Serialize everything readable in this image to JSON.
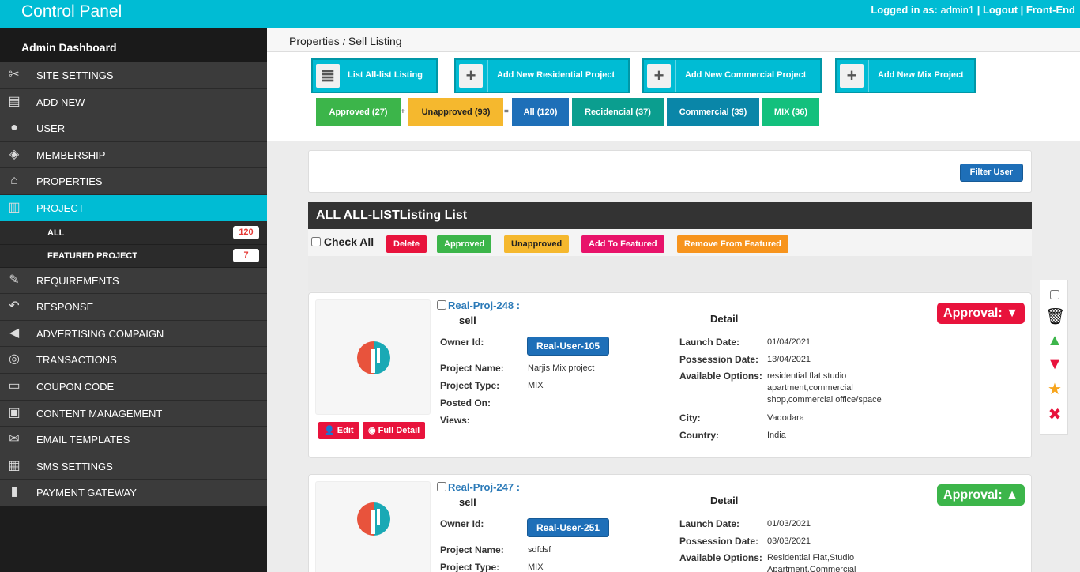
{
  "topbar": {
    "title": "Control Panel",
    "logged_in_label": "Logged in as:",
    "username": "admin1",
    "logout": "Logout",
    "frontend": "Front-End"
  },
  "sidebar": {
    "title": "Admin Dashboard",
    "items": [
      {
        "label": "SITE SETTINGS",
        "icon": "tools-icon"
      },
      {
        "label": "ADD NEW",
        "icon": "add-doc-icon"
      },
      {
        "label": "USER",
        "icon": "user-icon"
      },
      {
        "label": "MEMBERSHIP",
        "icon": "ticket-icon"
      },
      {
        "label": "PROPERTIES",
        "icon": "home-icon"
      },
      {
        "label": "PROJECT",
        "icon": "building-icon",
        "active": true
      }
    ],
    "sub_items": [
      {
        "label": "ALL",
        "badge": "120"
      },
      {
        "label": "FEATURED PROJECT",
        "badge": "7"
      }
    ],
    "items_after": [
      {
        "label": "REQUIREMENTS",
        "icon": "edit-icon"
      },
      {
        "label": "RESPONSE",
        "icon": "reply-icon"
      },
      {
        "label": "ADVERTISING COMPAIGN",
        "icon": "megaphone-icon"
      },
      {
        "label": "TRANSACTIONS",
        "icon": "globe-icon"
      },
      {
        "label": "COUPON CODE",
        "icon": "coupon-icon"
      },
      {
        "label": "CONTENT MANAGEMENT",
        "icon": "clipboard-icon"
      },
      {
        "label": "EMAIL TEMPLATES",
        "icon": "mail-icon"
      },
      {
        "label": "SMS SETTINGS",
        "icon": "sms-icon"
      },
      {
        "label": "PAYMENT GATEWAY",
        "icon": "gateway-icon"
      }
    ]
  },
  "breadcrumb": {
    "parent": "Properties",
    "separator": "/",
    "current": "Sell Listing"
  },
  "toolbar": {
    "list_all": "List All-list Listing",
    "add_residential": "Add New Residential Project",
    "add_commercial": "Add New Commercial Project",
    "add_mix": "Add New Mix Project"
  },
  "stats": {
    "approved": "Approved (27)",
    "plus": "+",
    "unapproved": "Unapproved (93)",
    "equals": "=",
    "all": "All (120)",
    "residential": "Recidencial (37)",
    "commercial": "Commercial (39)",
    "mix": "MIX (36)"
  },
  "filter": {
    "button": "Filter User"
  },
  "list": {
    "title": "ALL ALL-LISTListing List",
    "check_all": "Check All",
    "actions": {
      "delete": "Delete",
      "approved": "Approved",
      "unapproved": "Unapproved",
      "add_featured": "Add To Featured",
      "remove_featured": "Remove From Featured"
    }
  },
  "labels": {
    "owner_id": "Owner Id:",
    "project_name": "Project Name:",
    "project_type": "Project Type:",
    "posted_on": "Posted On:",
    "views": "Views:",
    "detail": "Detail",
    "launch_date": "Launch Date:",
    "possession_date": "Possession Date:",
    "available_options": "Available Options:",
    "city": "City:",
    "country": "Country:",
    "edit": "Edit",
    "full_detail": "Full Detail",
    "approval": "Approval:"
  },
  "cards": [
    {
      "id": "Real-Proj-248 :",
      "type": "sell",
      "owner": "Real-User-105",
      "project_name": "Narjis Mix project",
      "project_type": "MIX",
      "launch_date": "01/04/2021",
      "possession_date": "13/04/2021",
      "options_l1": "residential flat,studio",
      "options_l2": "apartment,commercial",
      "options_l3": "shop,commercial office/space",
      "city": "Vadodara",
      "country": "India",
      "approval_color": "#e8133c"
    },
    {
      "id": "Real-Proj-247 :",
      "type": "sell",
      "owner": "Real-User-251",
      "project_name": "sdfdsf",
      "project_type": "MIX",
      "launch_date": "01/03/2021",
      "possession_date": "03/03/2021",
      "options_l1": "Residential Flat,Studio",
      "options_l2": "Apartment,Commercial",
      "approval_color": "#3cb54a"
    }
  ],
  "colors": {
    "accent": "#00bcd4",
    "approved": "#3cb54a",
    "unapproved": "#f5b82e",
    "all": "#1e6fb8",
    "residential": "#0b9e8f",
    "commercial": "#0a86a8",
    "mix": "#13c07d",
    "danger": "#e8133c",
    "orange": "#f7941d"
  }
}
